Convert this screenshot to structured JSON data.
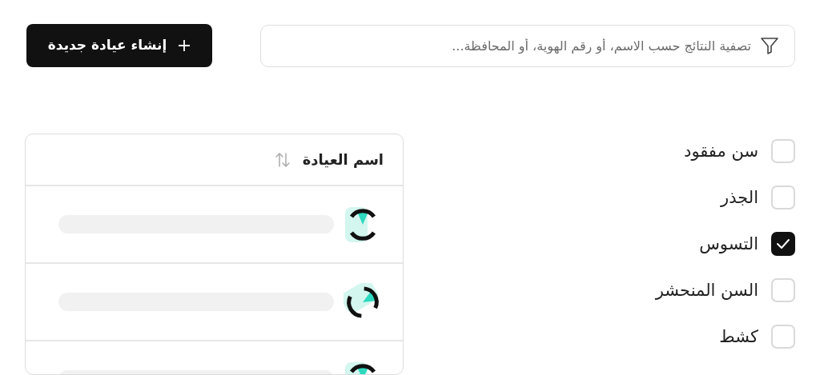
{
  "search": {
    "placeholder": "تصفية النتائج حسب الاسم، أو رقم الهوية، أو المحافظة..."
  },
  "create_button": {
    "label": "إنشاء عيادة جديدة"
  },
  "filters": [
    {
      "label": "سن مفقود",
      "checked": false
    },
    {
      "label": "الجذر",
      "checked": false
    },
    {
      "label": "التسوس",
      "checked": true
    },
    {
      "label": "السن المنحشر",
      "checked": false
    },
    {
      "label": "كشط",
      "checked": false
    }
  ],
  "table": {
    "columns": [
      {
        "label": "اسم العيادة"
      }
    ],
    "rows": [
      {
        "loading": true
      },
      {
        "loading": true
      },
      {
        "loading": true
      }
    ]
  }
}
